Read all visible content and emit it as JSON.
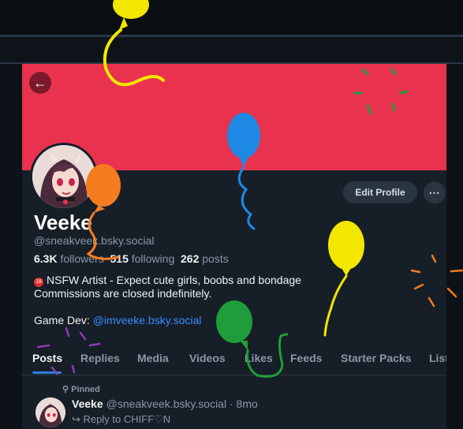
{
  "colors": {
    "banner": "#e8324e",
    "accent_blue": "#2f7de1",
    "link": "#3b8cff",
    "background": "#161e27"
  },
  "header": {
    "back_icon": "arrow-left-icon",
    "banner_color": "#e8324e"
  },
  "profile": {
    "display_name": "Veeke",
    "handle": "@sneakveek.bsky.social",
    "followers_count": "6.3K",
    "followers_label": "followers",
    "following_count": "515",
    "following_label": "following",
    "posts_count": "262",
    "posts_label": "posts",
    "edit_label": "Edit Profile",
    "more_label": "⋯",
    "bio_line1": "NSFW Artist - Expect cute girls, boobs and bondage",
    "bio_line2": "Commissions are closed indefinitely.",
    "bio_gamedev_prefix": "Game Dev: ",
    "bio_gamedev_link": "@imveeke.bsky.social",
    "age_badge": "18"
  },
  "tabs": [
    {
      "label": "Posts",
      "active": true
    },
    {
      "label": "Replies"
    },
    {
      "label": "Media"
    },
    {
      "label": "Videos"
    },
    {
      "label": "Likes"
    },
    {
      "label": "Feeds"
    },
    {
      "label": "Starter Packs"
    },
    {
      "label": "List"
    }
  ],
  "post": {
    "pinned_label": "Pinned",
    "author": "Veeke",
    "handle": "@sneakveek.bsky.social",
    "separator": "·",
    "time": "8mo",
    "reply_prefix": "Reply to",
    "reply_to": "CHIFF♡N"
  }
}
